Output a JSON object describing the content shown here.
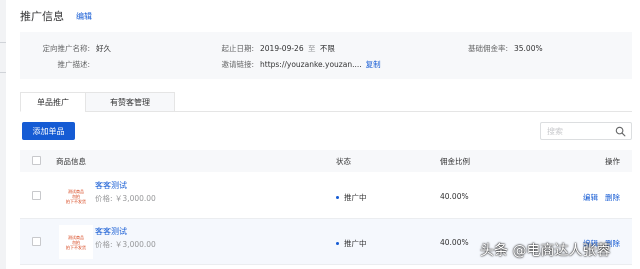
{
  "header": {
    "title": "推广信息",
    "edit_label": "编辑"
  },
  "info": {
    "target_promoter_label": "定向推广名称:",
    "target_promoter_value": "好久",
    "description_label": "推广描述:",
    "description_value": "",
    "date_label": "起止日期:",
    "date_start": "2019-09-26",
    "date_sep": "至",
    "date_end": "不限",
    "invite_label": "邀请链接:",
    "invite_value": "https://youzanke.youzan....",
    "copy_label": "复制",
    "base_rate_label": "基础佣金率:",
    "base_rate_value": "35.00%"
  },
  "tabs": [
    {
      "label": "单品推广",
      "active": true
    },
    {
      "label": "有赞客管理",
      "active": false
    }
  ],
  "toolbar": {
    "add_label": "添加单品",
    "search_placeholder": "搜索"
  },
  "table": {
    "headers": {
      "product": "商品信息",
      "status": "状态",
      "rate": "佣金比例",
      "actions": "操作"
    },
    "rows": [
      {
        "thumb_lines": [
          "测试商品",
          "勿拍",
          "拍下不发货"
        ],
        "name": "客客测试",
        "price": "价格: ￥3,000.00",
        "status": "推广中",
        "rate": "40.00%",
        "edit": "编辑",
        "delete": "删除"
      },
      {
        "thumb_lines": [
          "测试商品",
          "勿拍",
          "拍下不发货"
        ],
        "name": "客客测试",
        "price": "价格: ￥3,000.00",
        "status": "推广中",
        "rate": "40.00%",
        "edit": "编辑",
        "delete": "删除"
      }
    ]
  },
  "watermark": "头条 @电商达人张蓉",
  "colors": {
    "accent": "#155bd4",
    "panel": "#f7f8fa",
    "thumb_text": "#d4380d"
  }
}
